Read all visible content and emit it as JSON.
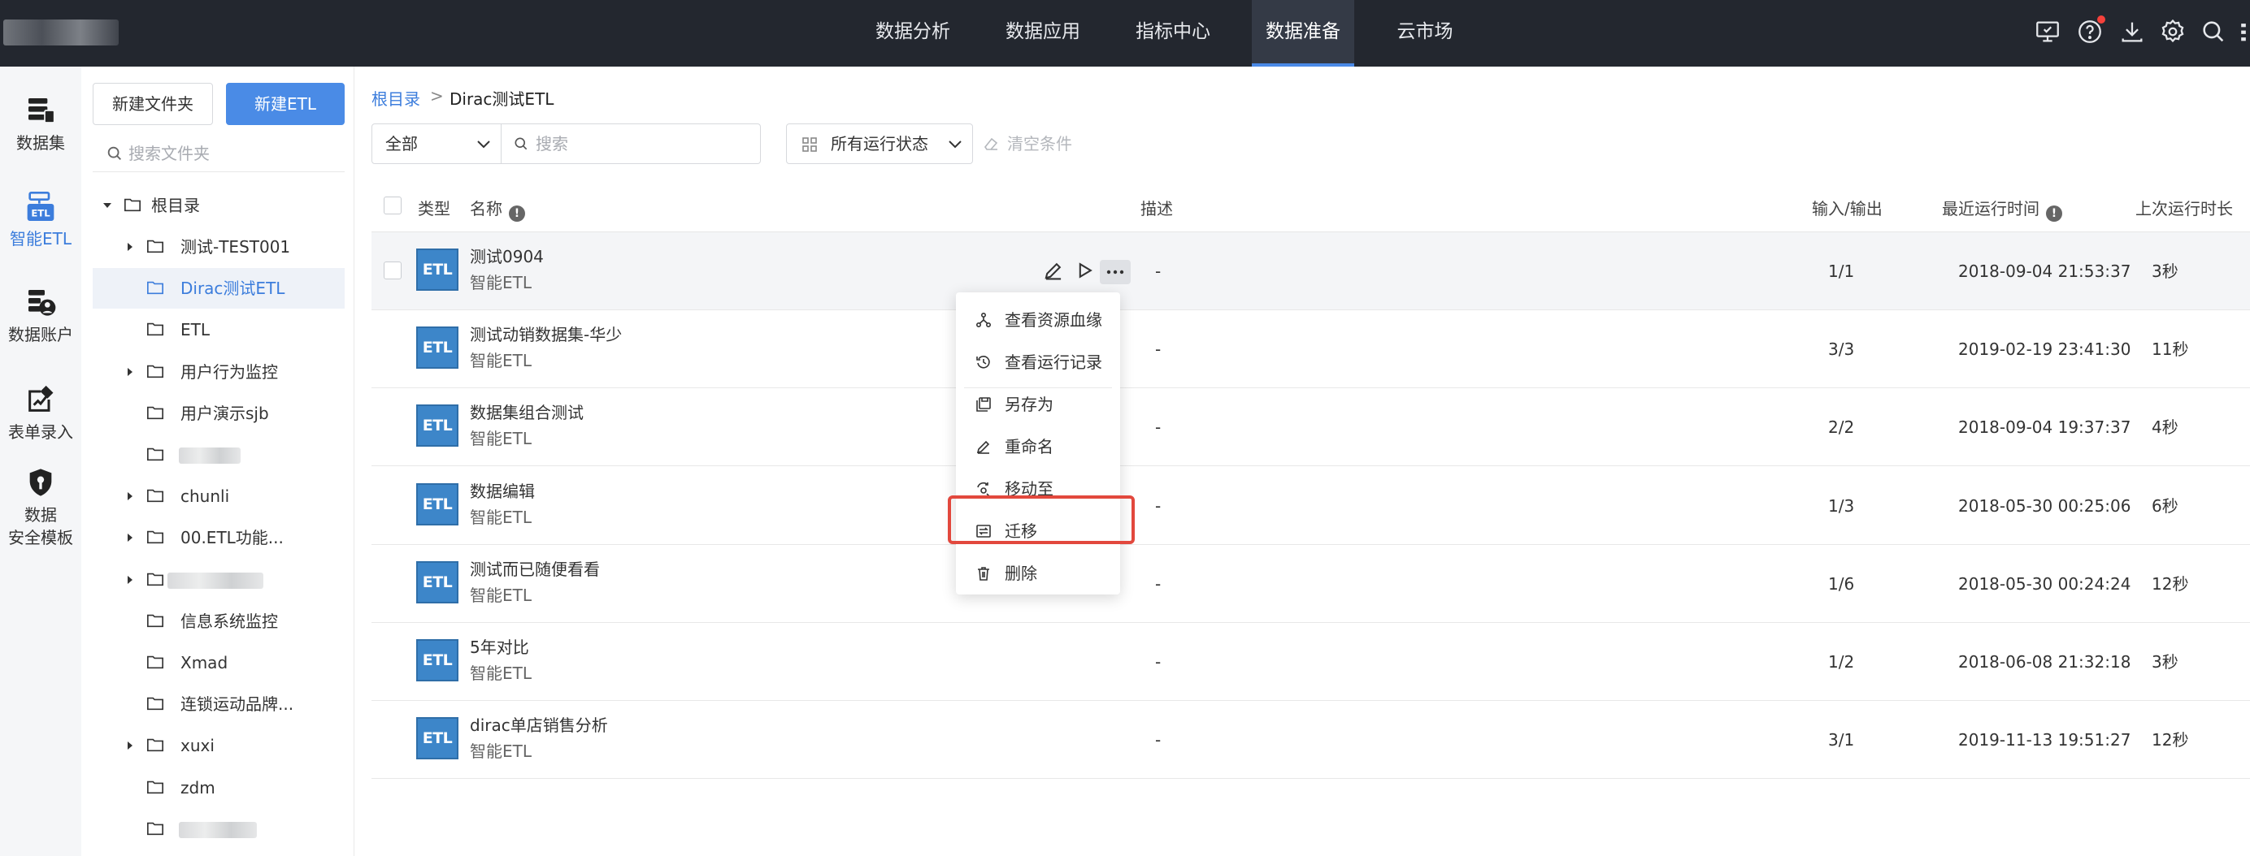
{
  "topnav": {
    "items": [
      "数据分析",
      "数据应用",
      "指标中心",
      "数据准备",
      "云市场"
    ],
    "active": "数据准备"
  },
  "top_icons": [
    "monitor-icon",
    "help-icon",
    "download-icon",
    "settings-icon",
    "search-icon"
  ],
  "rail": {
    "items": [
      {
        "label": "数据集",
        "icon": "dataset-icon"
      },
      {
        "label": "智能ETL",
        "icon": "etl-icon"
      },
      {
        "label": "数据账户",
        "icon": "data-account-icon"
      },
      {
        "label": "表单录入",
        "icon": "form-entry-icon"
      },
      {
        "label_line1": "数据",
        "label_line2": "安全模板",
        "icon": "security-template-icon"
      }
    ],
    "active": "智能ETL"
  },
  "folder_panel": {
    "new_folder_label": "新建文件夹",
    "new_etl_label": "新建ETL",
    "search_placeholder": "搜索文件夹",
    "root_label": "根目录",
    "tree": [
      {
        "label": "测试-TEST001",
        "expandable": true
      },
      {
        "label": "Dirac测试ETL",
        "expandable": false,
        "selected": true
      },
      {
        "label": "ETL",
        "expandable": false
      },
      {
        "label": "用户行为监控",
        "expandable": true
      },
      {
        "label": "用户演示sjb",
        "expandable": false
      },
      {
        "label": "",
        "expandable": false,
        "blurred": true
      },
      {
        "label": "chunli",
        "expandable": true
      },
      {
        "label": "00.ETL功能...",
        "expandable": true
      },
      {
        "label": "",
        "expandable": true,
        "blurred": true
      },
      {
        "label": "信息系统监控",
        "expandable": false
      },
      {
        "label": "Xmad",
        "expandable": false
      },
      {
        "label": "连锁运动品牌...",
        "expandable": false
      },
      {
        "label": "xuxi",
        "expandable": true
      },
      {
        "label": "zdm",
        "expandable": false
      },
      {
        "label": "",
        "expandable": false,
        "blurred": true
      }
    ]
  },
  "breadcrumb": {
    "root": "根目录",
    "separator": ">",
    "current": "Dirac测试ETL"
  },
  "filters": {
    "type_value": "全部",
    "search_placeholder": "搜索",
    "status_value": "所有运行状态",
    "clear_label": "清空条件"
  },
  "table": {
    "columns": [
      "类型",
      "名称",
      "描述",
      "输入/输出",
      "最近运行时间",
      "上次运行时长"
    ],
    "badge_text": "ETL",
    "rows": [
      {
        "name": "测试0904",
        "type": "智能ETL",
        "desc": "-",
        "io": "1/1",
        "last_run": "2018-09-04 21:53:37",
        "duration": "3秒"
      },
      {
        "name": "测试动销数据集-华少",
        "type": "智能ETL",
        "desc": "-",
        "io": "3/3",
        "last_run": "2019-02-19 23:41:30",
        "duration": "11秒"
      },
      {
        "name": "数据集组合测试",
        "type": "智能ETL",
        "desc": "-",
        "io": "2/2",
        "last_run": "2018-09-04 19:37:37",
        "duration": "4秒"
      },
      {
        "name": "数据编辑",
        "type": "智能ETL",
        "desc": "-",
        "io": "1/3",
        "last_run": "2018-05-30 00:25:06",
        "duration": "6秒"
      },
      {
        "name": "测试而已随便看看",
        "type": "智能ETL",
        "desc": "-",
        "io": "1/6",
        "last_run": "2018-05-30 00:24:24",
        "duration": "12秒"
      },
      {
        "name": "5年对比",
        "type": "智能ETL",
        "desc": "-",
        "io": "1/2",
        "last_run": "2018-06-08 21:32:18",
        "duration": "3秒"
      },
      {
        "name": "dirac单店销售分析",
        "type": "智能ETL",
        "desc": "-",
        "io": "3/1",
        "last_run": "2019-11-13 19:51:27",
        "duration": "12秒"
      }
    ]
  },
  "context_menu": {
    "items": [
      {
        "label": "查看资源血缘",
        "icon": "lineage-icon"
      },
      {
        "label": "查看运行记录",
        "icon": "run-history-icon"
      },
      {
        "label": "另存为",
        "icon": "save-as-icon"
      },
      {
        "label": "重命名",
        "icon": "rename-icon"
      },
      {
        "label": "移动至",
        "icon": "move-icon"
      },
      {
        "label": "迁移",
        "icon": "migrate-icon",
        "highlighted": true
      },
      {
        "label": "删除",
        "icon": "delete-icon"
      }
    ]
  },
  "colors": {
    "accent": "#4a8be6",
    "topbar": "#23272f",
    "highlight": "#e2483d",
    "etl_badge": "#3d86c9"
  }
}
